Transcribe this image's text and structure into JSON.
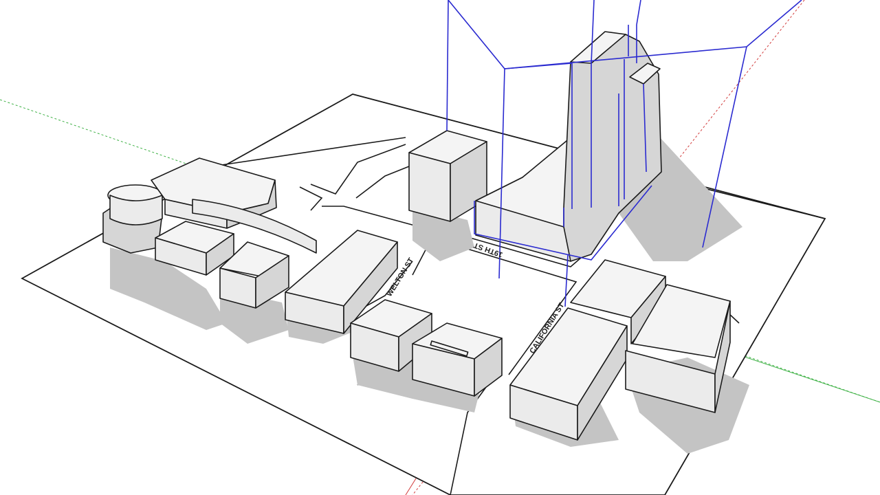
{
  "scene": {
    "streets": [
      {
        "label": "19TH ST"
      },
      {
        "label": "WELTON ST"
      },
      {
        "label": "CALIFORNIA ST"
      }
    ],
    "colors": {
      "background": "#ffffff",
      "building_fill": "#eeeeee",
      "building_shadow": "#c4c4c4",
      "edge": "#1a1a1a",
      "selection": "#2a2ad0",
      "axis_green": "#3cb043",
      "axis_red": "#d23c3c"
    }
  }
}
